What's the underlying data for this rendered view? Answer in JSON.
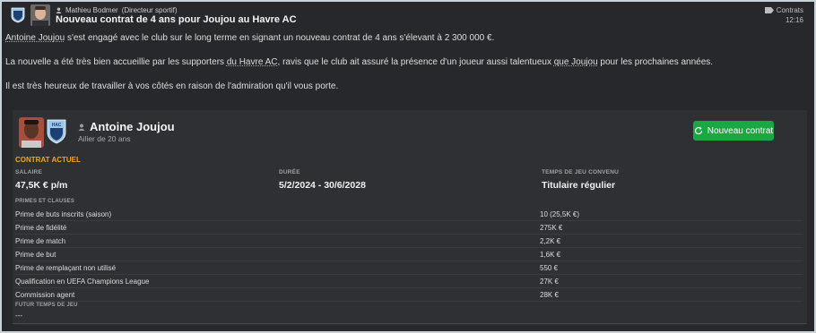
{
  "header": {
    "sender_name": "Mathieu Bodmer",
    "sender_role": "(Directeur sportif)",
    "subject": "Nouveau contrat de 4 ans pour Joujou au Havre AC",
    "category": "Contrats",
    "time": "12:16"
  },
  "message": {
    "p1_player": "Antoine Joujou",
    "p1_rest": " s'est engagé avec le club sur le long terme en signant un nouveau contrat de 4 ans s'élevant à 2 300 000 €.",
    "p2_a": "La nouvelle a été très bien accueillie par les supporters ",
    "p2_club": "du Havre AC",
    "p2_b": ", ravis que le club ait assuré la présence d'un joueur aussi talentueux ",
    "p2_player": "que Joujou",
    "p2_c": " pour les prochaines années.",
    "p3": "Il est très heureux de travailler à vos côtés en raison de l'admiration qu'il vous porte."
  },
  "player": {
    "name": "Antoine Joujou",
    "subtitle": "Ailier de 20 ans",
    "club_badge_text": "HAC",
    "new_contract_button": "Nouveau contrat"
  },
  "contract": {
    "section_title": "CONTRAT ACTUEL",
    "salary_label": "SALAIRE",
    "salary_value": "47,5K € p/m",
    "duration_label": "DURÉE",
    "duration_value": "5/2/2024 - 30/6/2028",
    "playtime_label": "TEMPS DE JEU CONVENU",
    "playtime_value": "Titulaire régulier",
    "bonuses_label": "PRIMES ET CLAUSES",
    "bonuses": [
      {
        "name": "Prime de buts inscrits (saison)",
        "value": "10 (25,5K €)"
      },
      {
        "name": "Prime de fidélité",
        "value": "275K €"
      },
      {
        "name": "Prime de match",
        "value": "2,2K €"
      },
      {
        "name": "Prime de but",
        "value": "1,6K €"
      },
      {
        "name": "Prime de remplaçant non utilisé",
        "value": "550 €"
      },
      {
        "name": "Qualification en UEFA Champions League",
        "value": "27K €"
      },
      {
        "name": "Commission agent",
        "value": "28K €"
      }
    ],
    "future_label": "FUTUR TEMPS DE JEU",
    "future_value": "---"
  },
  "colors": {
    "accent_orange": "#f3a51b",
    "button_green": "#1aa842"
  }
}
